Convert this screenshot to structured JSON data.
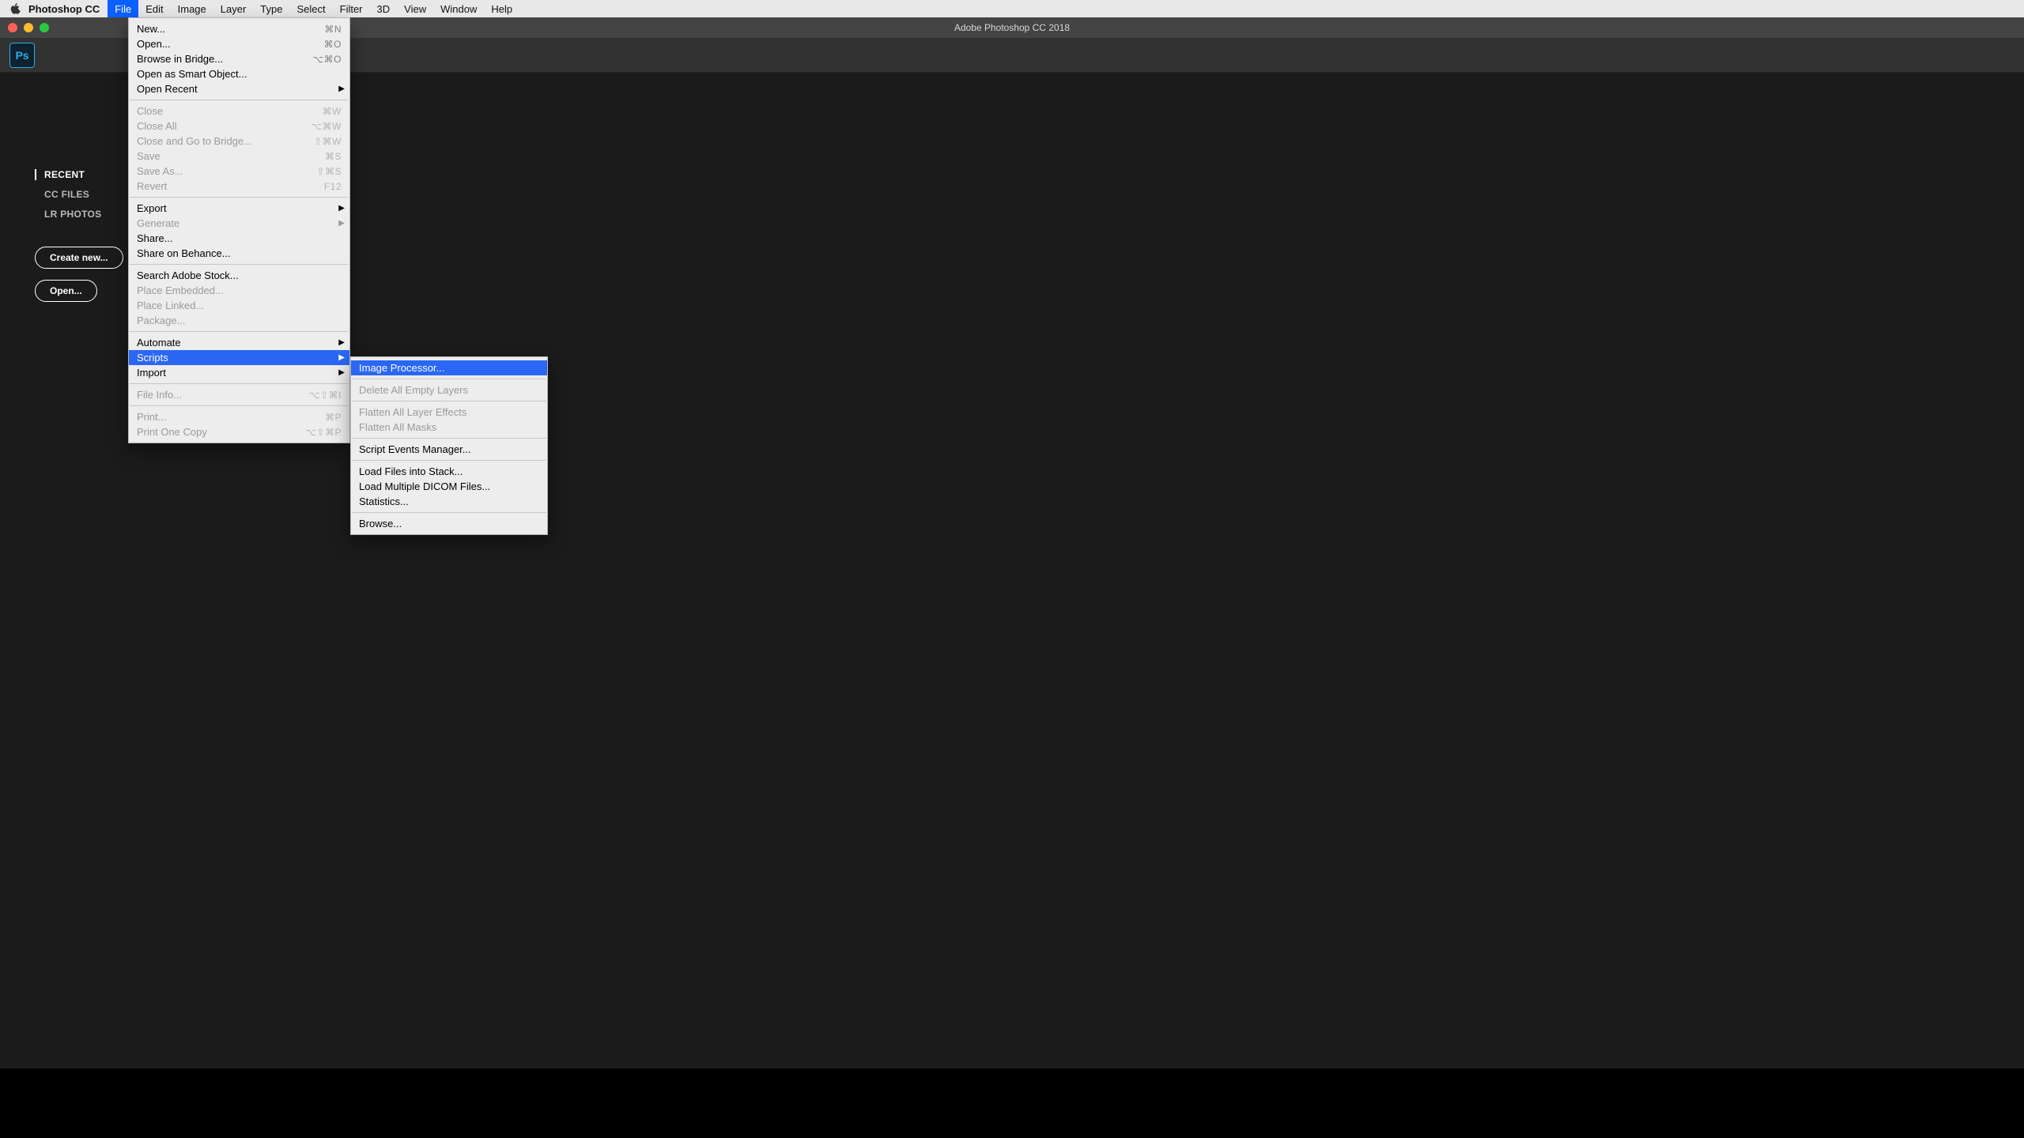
{
  "menubar": {
    "app": "Photoshop CC",
    "items": [
      "File",
      "Edit",
      "Image",
      "Layer",
      "Type",
      "Select",
      "Filter",
      "3D",
      "View",
      "Window",
      "Help"
    ],
    "active": "File"
  },
  "window": {
    "title": "Adobe Photoshop CC 2018",
    "ps_badge": "Ps"
  },
  "start": {
    "tabs": [
      "RECENT",
      "CC FILES",
      "LR PHOTOS"
    ],
    "active": 0,
    "create": "Create new...",
    "open": "Open..."
  },
  "file_menu": [
    {
      "t": "item",
      "label": "New...",
      "shortcut": "⌘N"
    },
    {
      "t": "item",
      "label": "Open...",
      "shortcut": "⌘O"
    },
    {
      "t": "item",
      "label": "Browse in Bridge...",
      "shortcut": "⌥⌘O"
    },
    {
      "t": "item",
      "label": "Open as Smart Object..."
    },
    {
      "t": "item",
      "label": "Open Recent",
      "sub": true
    },
    {
      "t": "sep"
    },
    {
      "t": "item",
      "label": "Close",
      "shortcut": "⌘W",
      "disabled": true
    },
    {
      "t": "item",
      "label": "Close All",
      "shortcut": "⌥⌘W",
      "disabled": true
    },
    {
      "t": "item",
      "label": "Close and Go to Bridge...",
      "shortcut": "⇧⌘W",
      "disabled": true
    },
    {
      "t": "item",
      "label": "Save",
      "shortcut": "⌘S",
      "disabled": true
    },
    {
      "t": "item",
      "label": "Save As...",
      "shortcut": "⇧⌘S",
      "disabled": true
    },
    {
      "t": "item",
      "label": "Revert",
      "shortcut": "F12",
      "disabled": true
    },
    {
      "t": "sep"
    },
    {
      "t": "item",
      "label": "Export",
      "sub": true
    },
    {
      "t": "item",
      "label": "Generate",
      "sub": true,
      "disabled": true
    },
    {
      "t": "item",
      "label": "Share..."
    },
    {
      "t": "item",
      "label": "Share on Behance..."
    },
    {
      "t": "sep"
    },
    {
      "t": "item",
      "label": "Search Adobe Stock..."
    },
    {
      "t": "item",
      "label": "Place Embedded...",
      "disabled": true
    },
    {
      "t": "item",
      "label": "Place Linked...",
      "disabled": true
    },
    {
      "t": "item",
      "label": "Package...",
      "disabled": true
    },
    {
      "t": "sep"
    },
    {
      "t": "item",
      "label": "Automate",
      "sub": true
    },
    {
      "t": "item",
      "label": "Scripts",
      "sub": true,
      "highlight": true
    },
    {
      "t": "item",
      "label": "Import",
      "sub": true
    },
    {
      "t": "sep"
    },
    {
      "t": "item",
      "label": "File Info...",
      "shortcut": "⌥⇧⌘I",
      "disabled": true
    },
    {
      "t": "sep"
    },
    {
      "t": "item",
      "label": "Print...",
      "shortcut": "⌘P",
      "disabled": true
    },
    {
      "t": "item",
      "label": "Print One Copy",
      "shortcut": "⌥⇧⌘P",
      "disabled": true
    }
  ],
  "scripts_menu": [
    {
      "t": "item",
      "label": "Image Processor...",
      "highlight": true
    },
    {
      "t": "sep"
    },
    {
      "t": "item",
      "label": "Delete All Empty Layers",
      "disabled": true
    },
    {
      "t": "sep"
    },
    {
      "t": "item",
      "label": "Flatten All Layer Effects",
      "disabled": true
    },
    {
      "t": "item",
      "label": "Flatten All Masks",
      "disabled": true
    },
    {
      "t": "sep"
    },
    {
      "t": "item",
      "label": "Script Events Manager..."
    },
    {
      "t": "sep"
    },
    {
      "t": "item",
      "label": "Load Files into Stack..."
    },
    {
      "t": "item",
      "label": "Load Multiple DICOM Files..."
    },
    {
      "t": "item",
      "label": "Statistics..."
    },
    {
      "t": "sep"
    },
    {
      "t": "item",
      "label": "Browse..."
    }
  ]
}
